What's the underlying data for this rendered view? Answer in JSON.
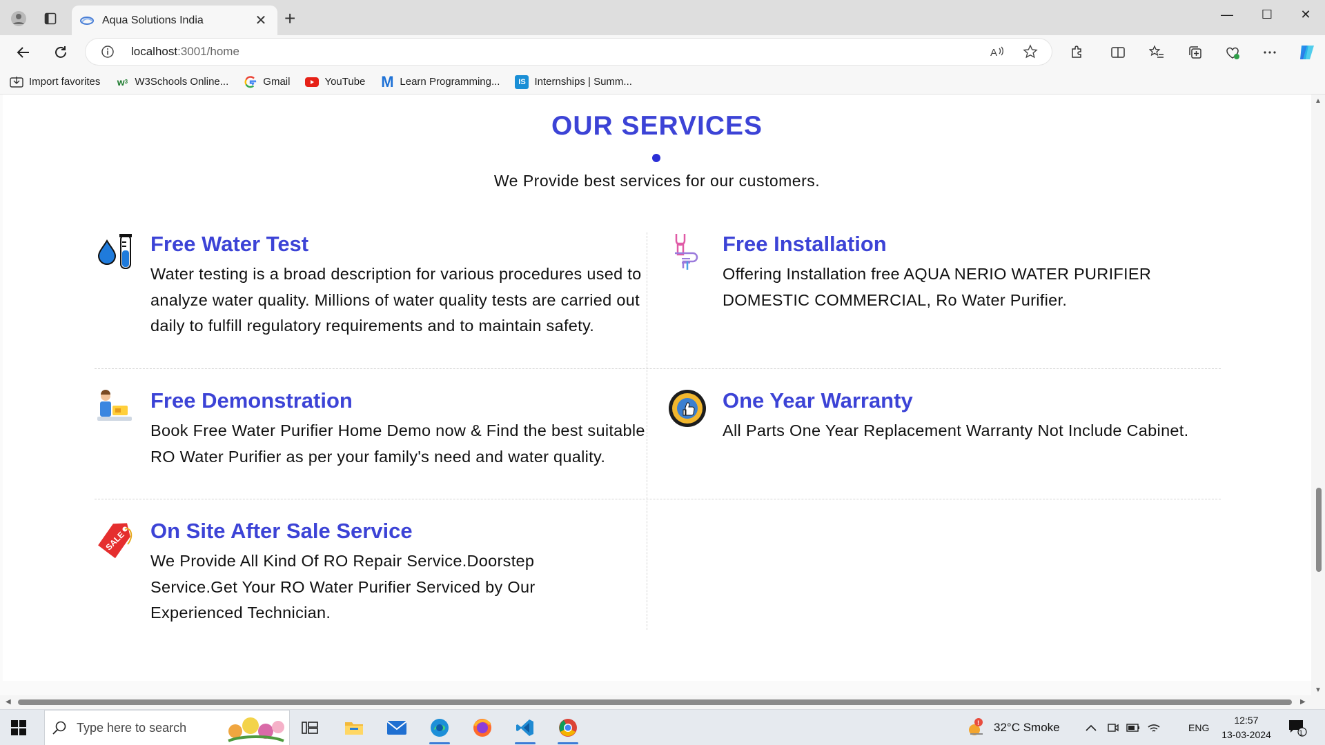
{
  "browser": {
    "tab_title": "Aqua Solutions India",
    "tab_close": "✕",
    "new_tab": "+",
    "url_host": "localhost",
    "url_rest": ":3001/home",
    "window_controls": [
      "—",
      "☐",
      "✕"
    ]
  },
  "favorites": [
    {
      "label": "Import favorites",
      "icon": "import-icon"
    },
    {
      "label": "W3Schools Online...",
      "icon": "w3schools-icon"
    },
    {
      "label": "Gmail",
      "icon": "google-icon"
    },
    {
      "label": "YouTube",
      "icon": "youtube-icon"
    },
    {
      "label": "Learn Programming...",
      "icon": "m-logo-icon"
    },
    {
      "label": "Internships | Summ...",
      "icon": "is-logo-icon"
    }
  ],
  "page": {
    "heading": "OUR SERVICES",
    "subtitle": "We Provide best services for our customers.",
    "services": [
      {
        "title": "Free Water Test",
        "text": "Water testing is a broad description for various procedures used to analyze water quality. Millions of water quality tests are carried out daily to fulfill regulatory requirements and to maintain safety.",
        "icon": "water-test-icon"
      },
      {
        "title": "Free Installation",
        "text": "Offering Installation free AQUA NERIO WATER PURIFIER DOMESTIC COMMERCIAL, Ro Water Purifier.",
        "icon": "installation-icon"
      },
      {
        "title": "Free Demonstration",
        "text": "Book Free Water Purifier Home Demo now & Find the best suitable RO Water Purifier as per your family's need and water quality.",
        "icon": "demonstration-icon"
      },
      {
        "title": "One Year Warranty",
        "text": "All Parts One Year Replacement Warranty Not Include Cabinet.",
        "icon": "warranty-badge-icon"
      },
      {
        "title": "On Site After Sale Service",
        "text": "We Provide All Kind Of RO Repair Service.Doorstep Service.Get Your RO Water Purifier Serviced by Our Experienced Technician.",
        "icon": "sale-tag-icon"
      }
    ]
  },
  "taskbar": {
    "search_placeholder": "Type here to search",
    "weather": "32°C  Smoke",
    "language": "ENG",
    "time": "12:57",
    "date": "13-03-2024",
    "notification_count": "1"
  },
  "colors": {
    "accent": "#3c43d6",
    "text": "#111111"
  }
}
